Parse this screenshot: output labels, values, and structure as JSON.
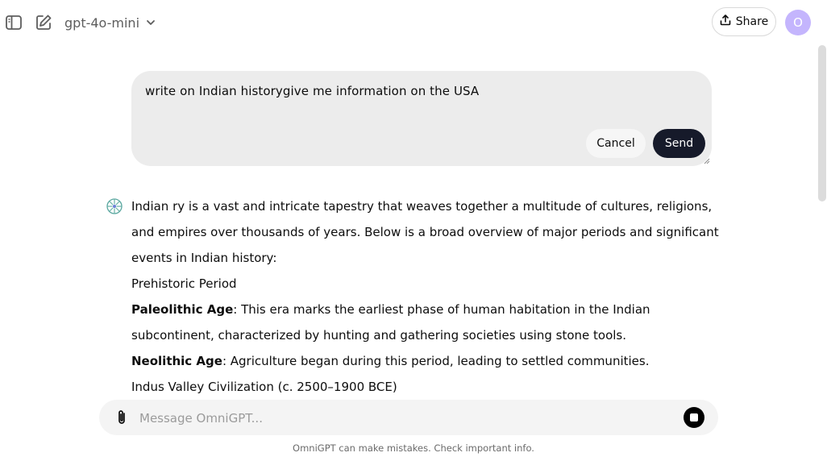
{
  "header": {
    "model_name": "gpt-4o-mini",
    "share_label": "Share",
    "avatar_initial": "O",
    "icons": [
      "sidebar-toggle-icon",
      "new-chat-icon",
      "chevron-down-icon",
      "share-icon"
    ]
  },
  "edit": {
    "text": "write on Indian historygive me information on the USA",
    "cancel_label": "Cancel",
    "send_label": "Send"
  },
  "answer": {
    "intro": "Indian ry is a vast and intricate tapestry that weaves together a multitude of cultures, religions, and empires over thousands of years. Below is a broad overview of major periods and significant events in Indian history:",
    "section1": "Prehistoric Period",
    "item1_term": "Paleolithic Age",
    "item1_text": ": This era marks the earliest phase of human habitation in the Indian subcontinent, characterized by hunting and gathering societies using stone tools.",
    "item2_term": "Neolithic Age",
    "item2_text": ": Agriculture began during this period, leading to settled communities.",
    "section2": "Indus Valley Civilization (c. 2500–1900 BCE)"
  },
  "composer": {
    "placeholder": "Message OmniGPT...",
    "icons": [
      "paperclip-icon",
      "stop-icon"
    ]
  },
  "footer": {
    "disclaimer": "OmniGPT can make mistakes. Check important info."
  },
  "colors": {
    "send_button": "#161a2a",
    "avatar": "#c4b5fd",
    "edit_bg": "#ececec",
    "composer_bg": "#f4f4f4"
  }
}
